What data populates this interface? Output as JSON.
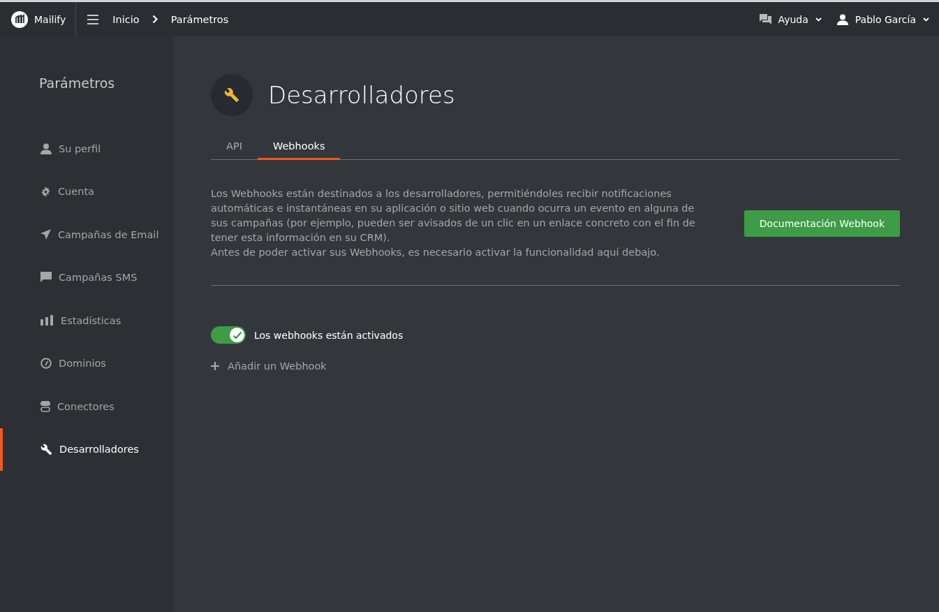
{
  "topbar": {
    "brand": "Mailify",
    "breadcrumb": [
      "Inicio",
      "Parámetros"
    ],
    "help": "Ayuda",
    "user": "Pablo García"
  },
  "sidebar": {
    "title": "Parámetros",
    "items": [
      {
        "label": "Su perfil",
        "selected": false
      },
      {
        "label": "Cuenta",
        "selected": false
      },
      {
        "label": "Campañas de Email",
        "selected": false
      },
      {
        "label": "Campañas SMS",
        "selected": false
      },
      {
        "label": "Estadísticas",
        "selected": false
      },
      {
        "label": "Dominios",
        "selected": false
      },
      {
        "label": "Conectores",
        "selected": false
      },
      {
        "label": "Desarrolladores",
        "selected": true
      }
    ]
  },
  "page": {
    "title": "Desarrolladores",
    "tabs": [
      {
        "label": "API",
        "selected": false
      },
      {
        "label": "Webhooks",
        "selected": true
      }
    ],
    "description": "Los Webhooks están destinados a los desarrolladores, permitiéndoles recibir notificaciones automáticas e instantáneas en su aplicación o sitio web cuando ocurra un evento en alguna de sus campañas (por ejemplo, pueden ser avisados de un clic en un enlace concreto con el fin de tener esta información en su CRM).",
    "note": "Antes de poder activar sus Webhooks, es necesario activar la funcionalidad aquí debajo.",
    "doc_button": "Documentación Webhook",
    "toggle": {
      "label": "Los webhooks están activados",
      "on": true
    },
    "add_link": "Añadir un Webhook"
  }
}
